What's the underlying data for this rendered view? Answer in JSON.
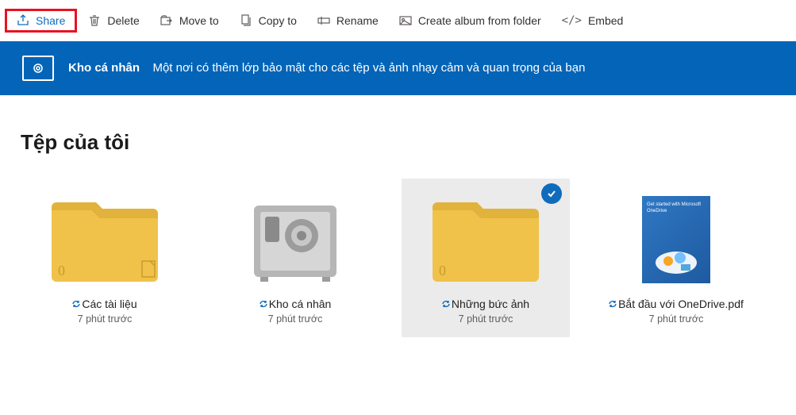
{
  "toolbar": {
    "share": "Share",
    "delete": "Delete",
    "moveTo": "Move to",
    "copyTo": "Copy to",
    "rename": "Rename",
    "createAlbum": "Create album from folder",
    "embed": "Embed"
  },
  "banner": {
    "title": "Kho cá nhân",
    "desc": "Một nơi có thêm lớp bảo mật cho các tệp và ảnh nhạy cảm và quan trọng của bạn"
  },
  "section_title": "Tệp của tôi",
  "items": {
    "documents": {
      "label": "Các tài liệu",
      "sub": "7 phút trước"
    },
    "vault": {
      "label": "Kho cá nhân",
      "sub": "7 phút trước"
    },
    "photos": {
      "label": "Những bức ảnh",
      "sub": "7 phút trước"
    },
    "pdf": {
      "label": "Bắt đầu với OneDrive.pdf",
      "sub": "7 phút trước",
      "thumb_text": "Get started with Microsoft OneDrive"
    }
  },
  "folder_badge": "0"
}
